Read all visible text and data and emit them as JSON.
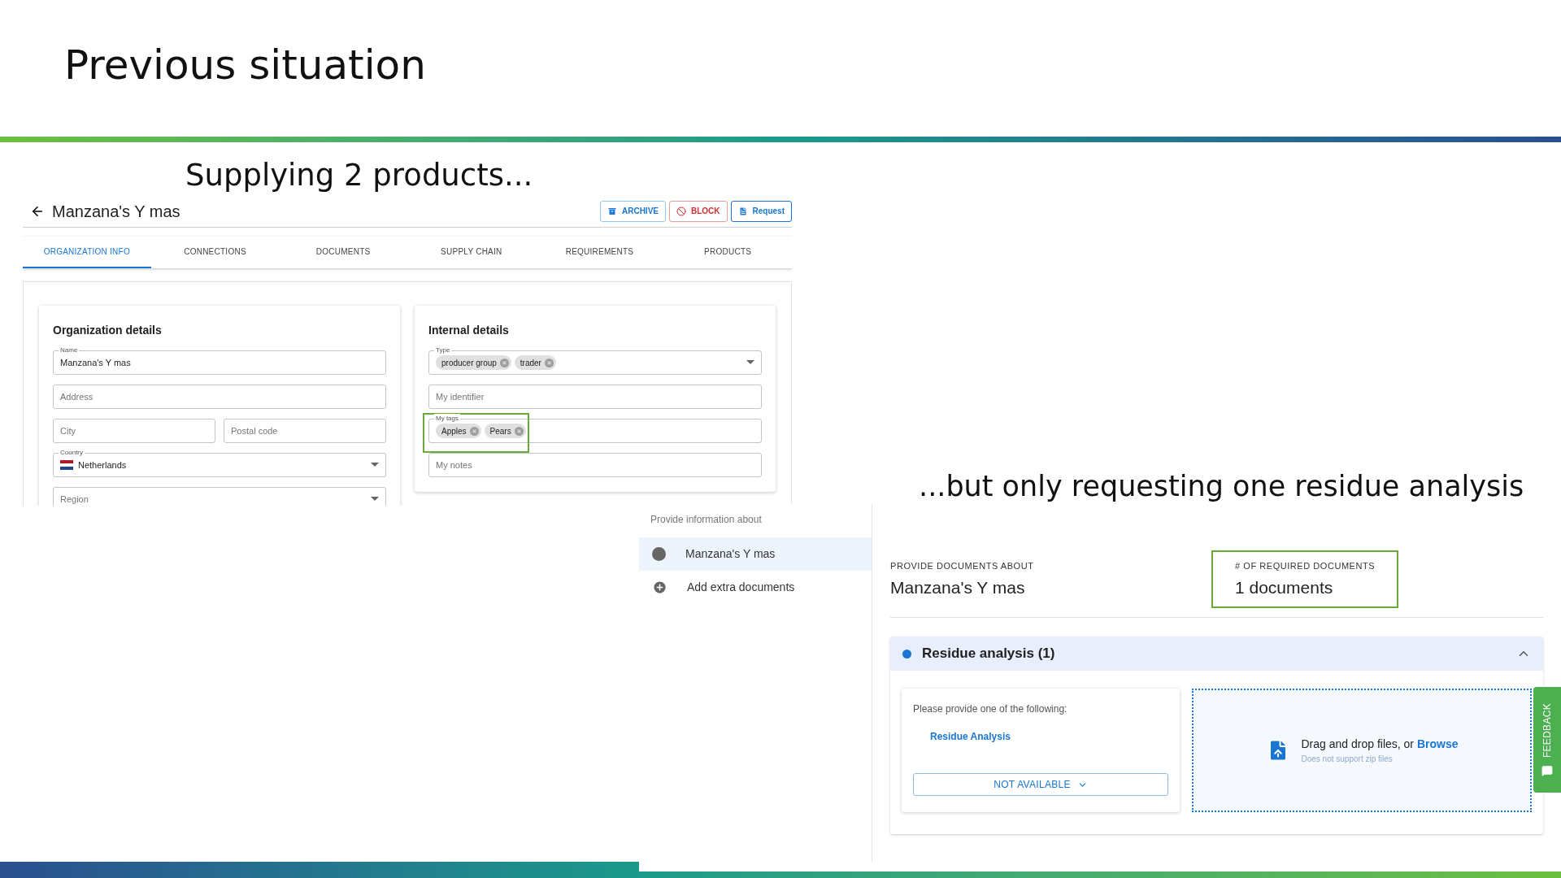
{
  "slide": {
    "title": "Previous situation",
    "left_caption": "Supplying 2 products...",
    "right_caption": "...but only requesting one residue analysis"
  },
  "org_page": {
    "title": "Manzana's Y mas",
    "actions": [
      {
        "label": "ARCHIVE",
        "kind": "archive"
      },
      {
        "label": "BLOCK",
        "kind": "block"
      },
      {
        "label": "Request",
        "kind": "request"
      }
    ],
    "tabs": [
      {
        "label": "ORGANIZATION INFO",
        "selected": true
      },
      {
        "label": "CONNECTIONS",
        "selected": false
      },
      {
        "label": "DOCUMENTS",
        "selected": false
      },
      {
        "label": "SUPPLY CHAIN",
        "selected": false
      },
      {
        "label": "REQUIREMENTS",
        "selected": false
      },
      {
        "label": "PRODUCTS",
        "selected": false
      }
    ],
    "cards": [
      {
        "title": "Organization details",
        "rows": [
          [
            {
              "kind": "text",
              "label": "Name",
              "value": "Manzana's Y mas",
              "highlighted": false
            }
          ],
          [
            {
              "kind": "text",
              "placeholder": "Address",
              "highlighted": false
            }
          ],
          [
            {
              "kind": "text",
              "placeholder": "City",
              "highlighted": false
            },
            {
              "kind": "text",
              "placeholder": "Postal code",
              "highlighted": false
            }
          ],
          [
            {
              "kind": "country",
              "label": "Country",
              "value": "Netherlands",
              "highlighted": false
            }
          ],
          [
            {
              "kind": "select",
              "placeholder": "Region",
              "highlighted": false
            }
          ]
        ]
      },
      {
        "title": "Internal details",
        "rows": [
          [
            {
              "kind": "select",
              "label": "Type",
              "chips": [
                "producer group",
                "trader"
              ],
              "highlighted": false
            }
          ],
          [
            {
              "kind": "text",
              "placeholder": "My identifier",
              "highlighted": false
            }
          ],
          [
            {
              "kind": "text",
              "label": "My tags",
              "chips": [
                "Apples",
                "Pears"
              ],
              "highlighted": true
            }
          ],
          [
            {
              "kind": "text",
              "placeholder": "My notes",
              "highlighted": false
            }
          ]
        ]
      }
    ]
  },
  "request_page": {
    "nav": {
      "heading": "Provide information about",
      "items": [
        {
          "label": "Manzana's Y mas",
          "kind": "entity",
          "selected": true
        },
        {
          "label": "Add extra documents",
          "kind": "add",
          "selected": false
        }
      ]
    },
    "summary": [
      {
        "label": "PROVIDE DOCUMENTS ABOUT",
        "value": "Manzana's Y mas",
        "highlighted": false
      },
      {
        "label": "# OF REQUIRED DOCUMENTS",
        "value": "1 documents",
        "highlighted": true
      }
    ],
    "section": {
      "title": "Residue analysis (1)",
      "expanded": true,
      "prompt": "Please provide one of the following:",
      "options": [
        "Residue Analysis"
      ],
      "status_button": "NOT AVAILABLE",
      "dropzone": {
        "text": "Drag and drop files, or",
        "link": "Browse",
        "note": "Does not support zip files"
      }
    },
    "feedback": "FEEDBACK"
  }
}
